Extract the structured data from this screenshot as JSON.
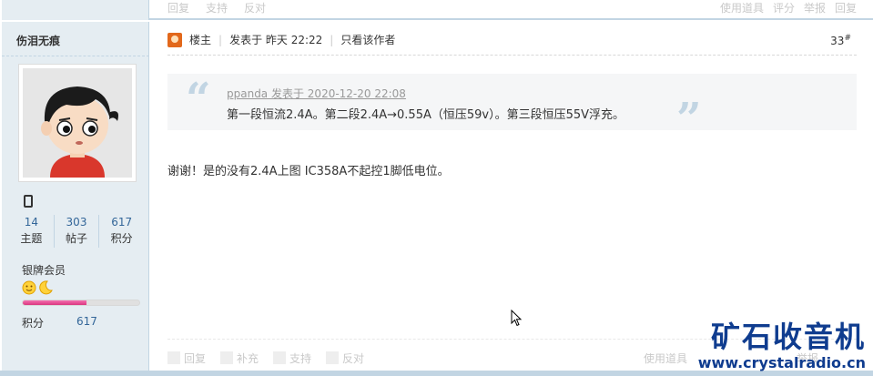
{
  "prev_post": {
    "actions": [
      "回复",
      "支持",
      "反对"
    ],
    "right": [
      "使用道具",
      "评分",
      "举报",
      "回复"
    ]
  },
  "author": {
    "name": "伤泪无痕",
    "stats": [
      {
        "value": "14",
        "label": "主题"
      },
      {
        "value": "303",
        "label": "帖子"
      },
      {
        "value": "617",
        "label": "积分"
      }
    ],
    "group": "银牌会员",
    "progress": 0.55,
    "credit_label": "积分",
    "credit_value": "617"
  },
  "post": {
    "badge": "楼主",
    "posted": "发表于 昨天 22:22",
    "only_author": "只看该作者",
    "floor": "33",
    "floor_mark": "#",
    "quote": {
      "author_line": "ppanda 发表于 2020-12-20 22:08",
      "text": "第一段恒流2.4A。第二段2.4A→0.55A（恒压59v）。第三段恒压55V浮充。"
    },
    "body": "谢谢！是的没有2.4A上图 IC358A不起控1脚低电位。",
    "actions": [
      "回复",
      "补充",
      "支持",
      "反对"
    ],
    "bottom_right": [
      "使用道具",
      "举报"
    ]
  },
  "watermark": {
    "title": "矿石收音机",
    "url": "www.crystalradio.cn"
  },
  "colors": {
    "sidebar_bg": "#e5edf2",
    "border": "#c2d5e3",
    "link": "#336699",
    "watermark": "#0f3c8f"
  }
}
